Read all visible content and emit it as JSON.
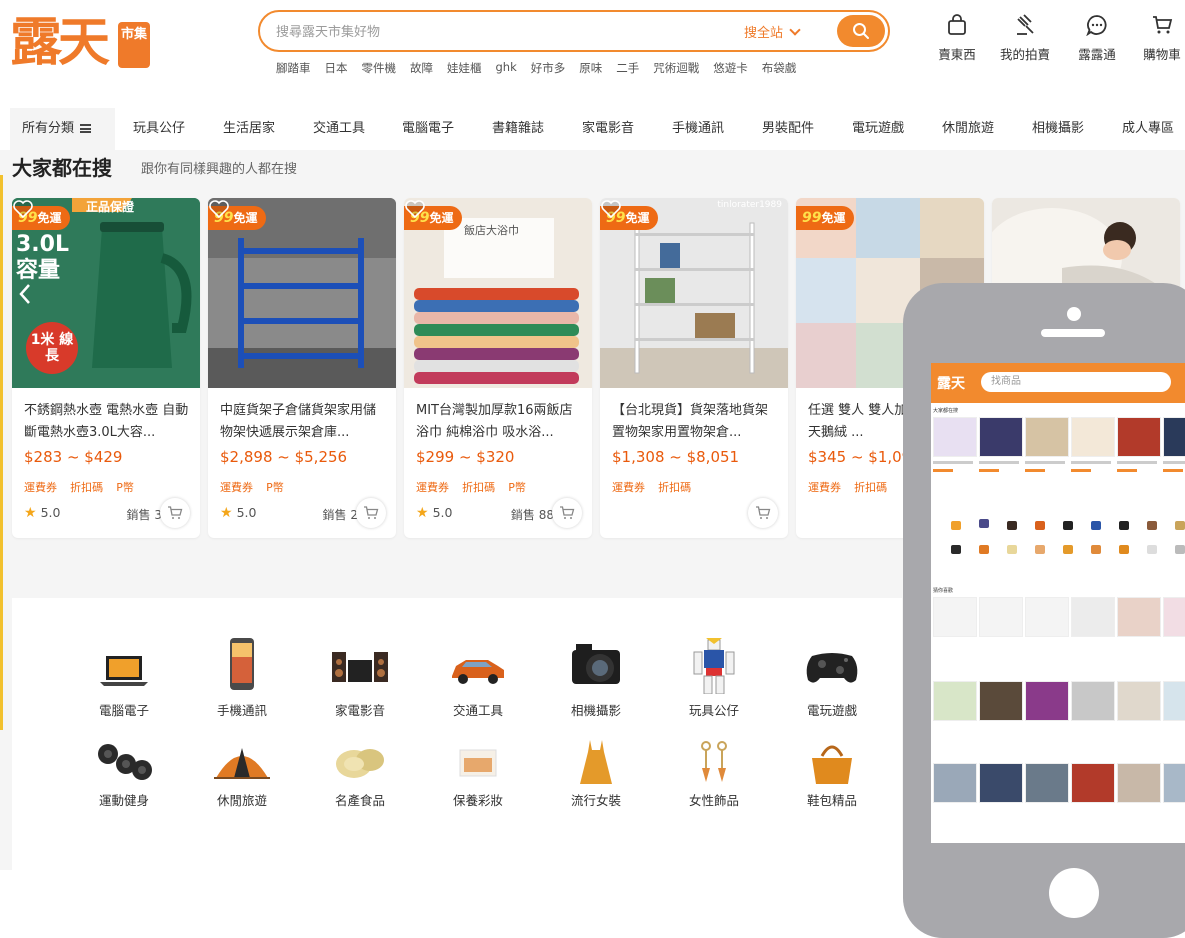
{
  "header": {
    "logo_text": "露天",
    "logo_tag": "市集",
    "search_placeholder": "搜尋露天市集好物",
    "search_scope": "搜全站",
    "hot_keywords": [
      "腳踏車",
      "日本",
      "零件機",
      "故障",
      "娃娃櫃",
      "ghk",
      "好市多",
      "原味",
      "二手",
      "咒術迴戰",
      "悠遊卡",
      "布袋戲"
    ],
    "actions": [
      {
        "label": "賣東西",
        "icon": "bag-icon"
      },
      {
        "label": "我的拍賣",
        "icon": "gavel-icon"
      },
      {
        "label": "露露通",
        "icon": "chat-icon"
      },
      {
        "label": "購物車",
        "icon": "cart-icon"
      }
    ]
  },
  "nav": {
    "all_label": "所有分類",
    "categories": [
      "玩具公仔",
      "生活居家",
      "交通工具",
      "電腦電子",
      "書籍雜誌",
      "家電影音",
      "手機通訊",
      "男裝配件",
      "電玩遊戲",
      "休閒旅遊",
      "相機攝影",
      "成人專區"
    ]
  },
  "section": {
    "title": "大家都在搜",
    "subtitle": "跟你有同樣興趣的人都在搜"
  },
  "cards": [
    {
      "badge_num": "99",
      "badge_text": "免運",
      "title": "不銹鋼熱水壺 電熱水壺 自動斷電熱水壺3.0L大容...",
      "price": "$283 ~ $429",
      "tags": [
        "運費券",
        "折扣碼",
        "P幣"
      ],
      "rating": "5.0",
      "sales": "銷售 3",
      "image_text": "正品保證",
      "image_big": "3.0L 容量",
      "image_badge": "1米 線長"
    },
    {
      "badge_num": "99",
      "badge_text": "免運",
      "title": "中庭貨架子倉儲貨架家用儲物架快遞展示架倉庫...",
      "price": "$2,898 ~ $5,256",
      "tags": [
        "運費券",
        "P幣"
      ],
      "rating": "5.0",
      "sales": "銷售 2"
    },
    {
      "badge_num": "99",
      "badge_text": "免運",
      "title": "MIT台灣製加厚款16兩飯店浴巾 純棉浴巾 吸水浴...",
      "price": "$299 ~ $320",
      "tags": [
        "運費券",
        "折扣碼",
        "P幣"
      ],
      "rating": "5.0",
      "sales": "銷售 88",
      "image_text": "飯店大浴巾"
    },
    {
      "badge_num": "99",
      "badge_text": "免運",
      "title": "【台北現貨】貨架落地貨架置物架家用置物架倉...",
      "price": "$1,308 ~ $8,051",
      "tags": [
        "運費券",
        "折扣碼"
      ],
      "rating": "",
      "sales": "",
      "image_text": "tinlorater1989"
    },
    {
      "badge_num": "99",
      "badge_text": "免運",
      "title": "任選 雙人 雙人加大 舒柔棉 天鵝絨 ...",
      "price": "$345 ~ $1,09",
      "tags": [
        "運費券",
        "折扣碼"
      ],
      "rating": "",
      "sales": ""
    }
  ],
  "category_icons": [
    {
      "label": "電腦電子",
      "icon": "laptop-icon"
    },
    {
      "label": "手機通訊",
      "icon": "phone-icon"
    },
    {
      "label": "家電影音",
      "icon": "speaker-icon"
    },
    {
      "label": "交通工具",
      "icon": "car-icon"
    },
    {
      "label": "相機攝影",
      "icon": "camera-icon"
    },
    {
      "label": "玩具公仔",
      "icon": "robot-icon"
    },
    {
      "label": "電玩遊戲",
      "icon": "gamepad-icon"
    },
    {
      "label": "運動健身",
      "icon": "dumbbell-icon"
    },
    {
      "label": "休閒旅遊",
      "icon": "tent-icon"
    },
    {
      "label": "名產食品",
      "icon": "food-icon"
    },
    {
      "label": "保養彩妝",
      "icon": "cosmetics-icon"
    },
    {
      "label": "流行女裝",
      "icon": "dress-icon"
    },
    {
      "label": "女性飾品",
      "icon": "earrings-icon"
    },
    {
      "label": "鞋包精品",
      "icon": "handbag-icon"
    }
  ],
  "phone": {
    "logo": "露天",
    "search_placeholder": "找商品",
    "section1": "大家都在搜",
    "section2": "猜你喜歡"
  },
  "colors": {
    "brand_orange": "#f28a2e",
    "price": "#e95a0c",
    "badge": "#ee6a14"
  }
}
